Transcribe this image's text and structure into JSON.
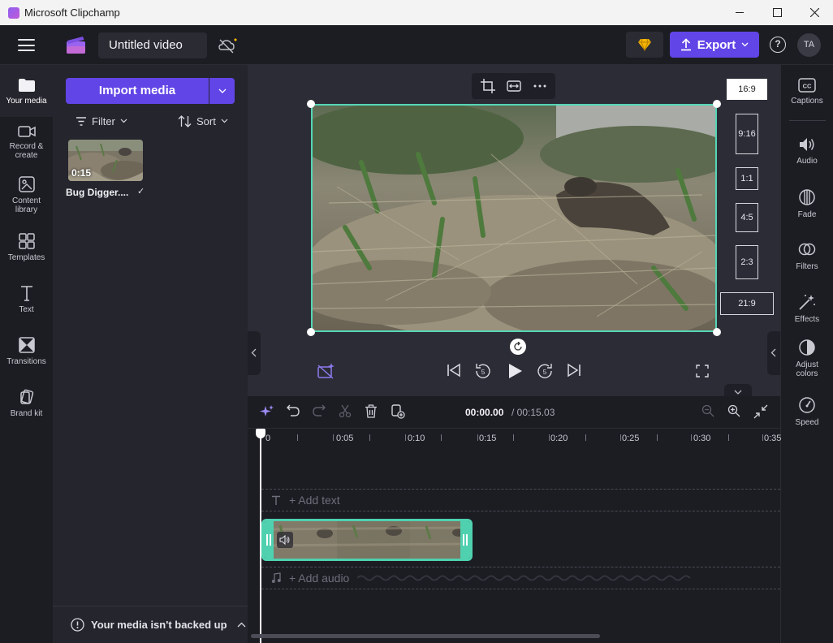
{
  "window": {
    "title": "Microsoft Clipchamp"
  },
  "header": {
    "project_title": "Untitled video",
    "export_label": "Export",
    "help_label": "?",
    "avatar_initials": "TA"
  },
  "leftnav": {
    "items": [
      {
        "label": "Your media",
        "icon": "folder-icon",
        "active": true
      },
      {
        "label": "Record & create",
        "icon": "camera-icon"
      },
      {
        "label": "Content library",
        "icon": "library-icon"
      },
      {
        "label": "Templates",
        "icon": "templates-icon"
      },
      {
        "label": "Text",
        "icon": "text-icon"
      },
      {
        "label": "Transitions",
        "icon": "transitions-icon"
      },
      {
        "label": "Brand kit",
        "icon": "brand-kit-icon"
      }
    ]
  },
  "media_panel": {
    "import_label": "Import media",
    "filter_label": "Filter",
    "sort_label": "Sort",
    "items": [
      {
        "name": "Bug Digger....",
        "duration": "0:15",
        "added": "✓"
      }
    ],
    "backup_message": "Your media isn't backed up"
  },
  "preview": {
    "aspect_ratios": [
      "16:9",
      "9:16",
      "1:1",
      "4:5",
      "2:3",
      "21:9"
    ],
    "selected_ratio": "16:9"
  },
  "rightpanel": {
    "items": [
      {
        "label": "Captions",
        "icon": "captions-icon"
      },
      {
        "label": "Audio",
        "icon": "speaker-icon"
      },
      {
        "label": "Fade",
        "icon": "fade-icon"
      },
      {
        "label": "Filters",
        "icon": "filters-icon"
      },
      {
        "label": "Effects",
        "icon": "effects-icon"
      },
      {
        "label": "Adjust colors",
        "icon": "adjust-colors-icon"
      },
      {
        "label": "Speed",
        "icon": "speed-icon"
      }
    ]
  },
  "timeline": {
    "current_time": "00:00.00",
    "total_time": "/ 00:15.03",
    "ruler_labels": [
      "0",
      "0:05",
      "0:10",
      "0:15",
      "0:20",
      "0:25",
      "0:30",
      "0:35"
    ],
    "add_text_label": "+ Add text",
    "add_audio_label": "+ Add audio"
  },
  "colors": {
    "accent": "#6245e6",
    "selection": "#55d6b6",
    "premium": "#f4b400"
  }
}
